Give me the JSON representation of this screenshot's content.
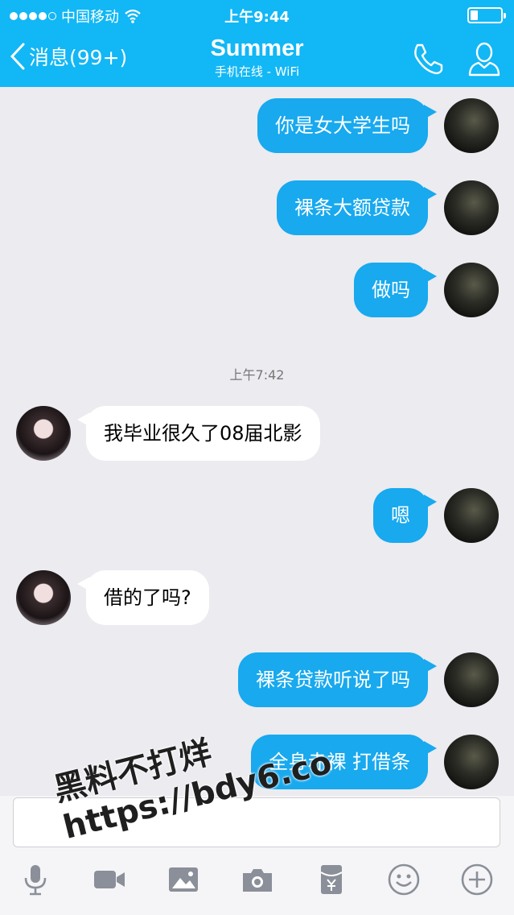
{
  "status": {
    "carrier": "中国移动",
    "time": "上午9:44",
    "signal_bars": 4,
    "signal_max": 5,
    "battery_level": 0.25
  },
  "nav": {
    "back_label": "消息(99+)",
    "title": "Summer",
    "subtitle": "手机在线 - WiFi"
  },
  "messages": [
    {
      "side": "out",
      "text": "你是女大学生吗"
    },
    {
      "side": "out",
      "text": "裸条大额贷款"
    },
    {
      "side": "out",
      "text": "做吗"
    },
    {
      "side": "in",
      "text": "我毕业很久了08届北影"
    },
    {
      "side": "out",
      "text": "嗯"
    },
    {
      "side": "in",
      "text": "借的了吗?"
    },
    {
      "side": "out",
      "text": "裸条贷款听说了吗"
    },
    {
      "side": "out",
      "text": "全身赤裸 打借条"
    }
  ],
  "timestamp": "上午7:42",
  "input": {
    "value": "",
    "placeholder": ""
  },
  "toolbar": [
    "mic-icon",
    "video-icon",
    "image-icon",
    "camera-icon",
    "red-packet-icon",
    "emoji-icon",
    "plus-icon"
  ],
  "watermark": {
    "line1": "黑料不打烊",
    "line2": "https://bdy6.co"
  },
  "colors": {
    "accent": "#12b7f5",
    "bubble_out": "#18a9ee",
    "bubble_in": "#ffffff",
    "background": "#ebebf0"
  }
}
